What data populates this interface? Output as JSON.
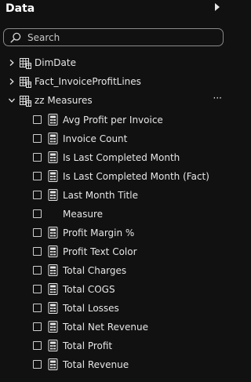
{
  "pane": {
    "title": "Data"
  },
  "search": {
    "placeholder": "Search",
    "value": ""
  },
  "tables": [
    {
      "label": "DimDate",
      "expanded": false
    },
    {
      "label": "Fact_InvoiceProfitLines",
      "expanded": false
    },
    {
      "label": "zz Measures",
      "expanded": true,
      "more": "···"
    }
  ],
  "measures": [
    {
      "label": "Avg Profit per Invoice",
      "checked": false,
      "icon": "calculator-icon"
    },
    {
      "label": "Invoice Count",
      "checked": false,
      "icon": "calculator-icon"
    },
    {
      "label": "Is Last Completed Month",
      "checked": false,
      "icon": "calculator-icon"
    },
    {
      "label": "Is Last Completed Month (Fact)",
      "checked": false,
      "icon": "calculator-icon"
    },
    {
      "label": "Last Month Title",
      "checked": false,
      "icon": "calculator-icon"
    },
    {
      "label": "Measure",
      "checked": false,
      "icon": ""
    },
    {
      "label": "Profit Margin %",
      "checked": false,
      "icon": "calculator-icon"
    },
    {
      "label": "Profit Text Color",
      "checked": false,
      "icon": "calculator-icon"
    },
    {
      "label": "Total Charges",
      "checked": false,
      "icon": "calculator-icon"
    },
    {
      "label": "Total COGS",
      "checked": false,
      "icon": "calculator-icon"
    },
    {
      "label": "Total Losses",
      "checked": false,
      "icon": "calculator-icon"
    },
    {
      "label": "Total Net Revenue",
      "checked": false,
      "icon": "calculator-icon"
    },
    {
      "label": "Total Profit",
      "checked": false,
      "icon": "calculator-icon"
    },
    {
      "label": "Total Revenue",
      "checked": false,
      "icon": "calculator-icon"
    }
  ]
}
